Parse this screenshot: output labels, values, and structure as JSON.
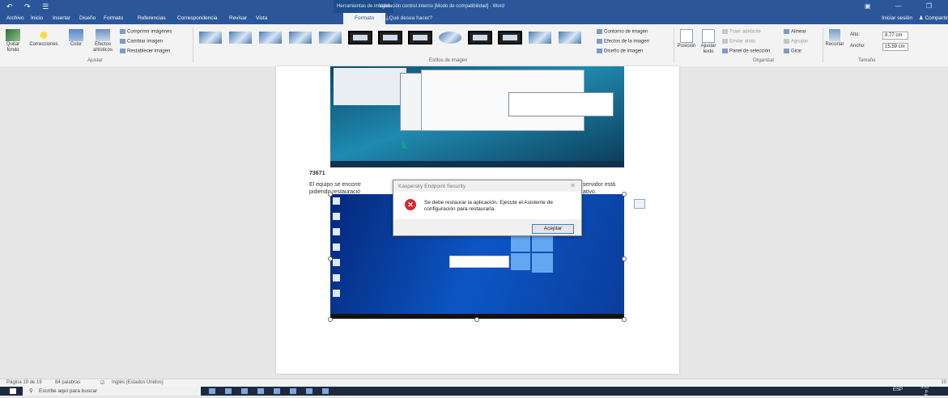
{
  "titlebar": {
    "quick_access": "↶ ↷ ☰",
    "context_group": "Herramientas de imagen",
    "title": "Validación control interno [Modo de compatibilidad] - Word",
    "window_controls": "▣ — ❐"
  },
  "tabs": [
    "Archivo",
    "Inicio",
    "Insertar",
    "Diseño",
    "Formato",
    "Referencias",
    "Correspondencia",
    "Revisar",
    "Vista",
    "Formato"
  ],
  "tell_me": "¿Qué desea hacer?",
  "account": {
    "signin": "Iniciar sesión",
    "share": "Compartir"
  },
  "ribbon": {
    "ajustar": {
      "quitar_fondo": "Quitar fondo",
      "correcciones": "Correcciones",
      "color": "Color",
      "efectos": "Efectos artísticos",
      "comprimir": "Comprimir imágenes",
      "cambiar": "Cambiar imagen",
      "restablecer": "Restablecer imagen",
      "label": "Ajustar"
    },
    "estilos": {
      "label": "Estilos de imagen",
      "contorno": "Contorno de imagen",
      "efectos": "Efectos de la imagen",
      "diseno": "Diseño de imagen"
    },
    "organizar": {
      "posicion": "Posición",
      "ajustar_texto": "Ajustar texto",
      "traer": "Traer adelante",
      "enviar": "Enviar atrás",
      "panel": "Panel de selección",
      "alinear": "Alinear",
      "agrupar": "Agrupar",
      "girar": "Girar",
      "label": "Organizar"
    },
    "tamano": {
      "recortar": "Recortar",
      "alto_label": "Alto:",
      "alto_value": "8,77 cm",
      "ancho_label": "Ancho:",
      "ancho_value": "15,59 cm",
      "label": "Tamaño"
    }
  },
  "document": {
    "caption": "73671",
    "paragraph_left": "El equipo se encontr",
    "paragraph_left2": "pidiendo restauració",
    "paragraph_right": "servidor está",
    "paragraph_right2": "ativo."
  },
  "dialog": {
    "title": "Kaspersky Endpoint Security",
    "close": "✕",
    "message": "Se debe restaurar la aplicación. Ejecute el Asistente de configuración para restaurarla.",
    "ok": "Aceptar"
  },
  "statusbar": {
    "page": "Página 19 de 19",
    "words": "84 palabras",
    "language": "Inglés (Estados Unidos)",
    "zoom": "10"
  },
  "taskbar": {
    "search": "Escribe aquí para buscar",
    "lang": "ESP",
    "time": "3:05 p. m."
  }
}
